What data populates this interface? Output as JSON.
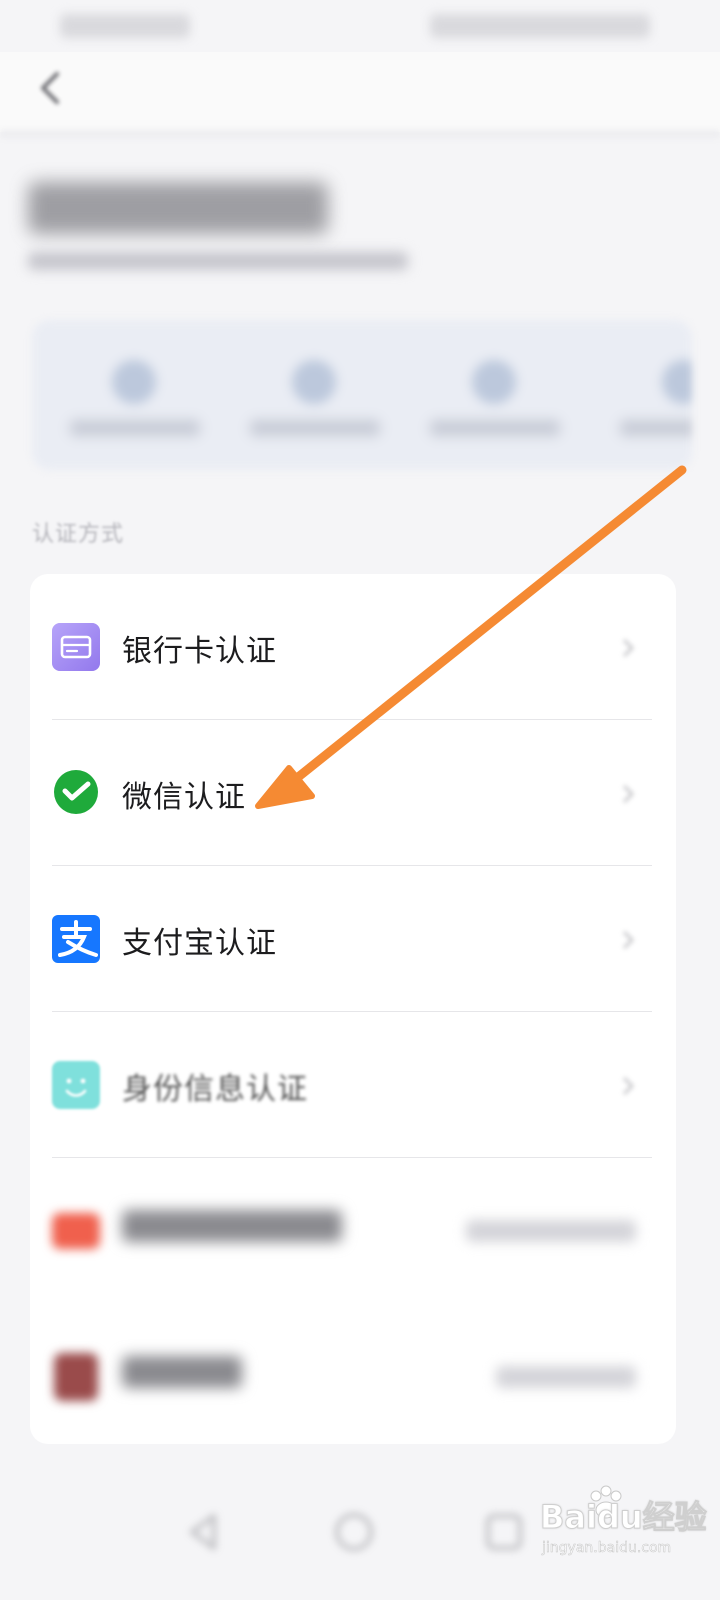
{
  "section": {
    "label": "认证方式"
  },
  "methods": [
    {
      "label": "银行卡认证",
      "icon": "bank-card-icon",
      "color": "#9b86f0"
    },
    {
      "label": "微信认证",
      "icon": "wechat-pay-icon",
      "color": "#1faa3b"
    },
    {
      "label": "支付宝认证",
      "icon": "alipay-icon",
      "color": "#1677ff"
    },
    {
      "label": "身份信息认证",
      "icon": "face-id-icon",
      "color": "#6fdcd8"
    },
    {
      "label": "",
      "icon": "certificate-icon",
      "color": "#f0604d"
    },
    {
      "label": "",
      "icon": "passport-icon",
      "color": "#9a4b4b"
    }
  ],
  "annotation": {
    "color": "#f58a33"
  },
  "watermark": {
    "main": "Baidu经验",
    "sub": "jingyan.baidu.com"
  }
}
